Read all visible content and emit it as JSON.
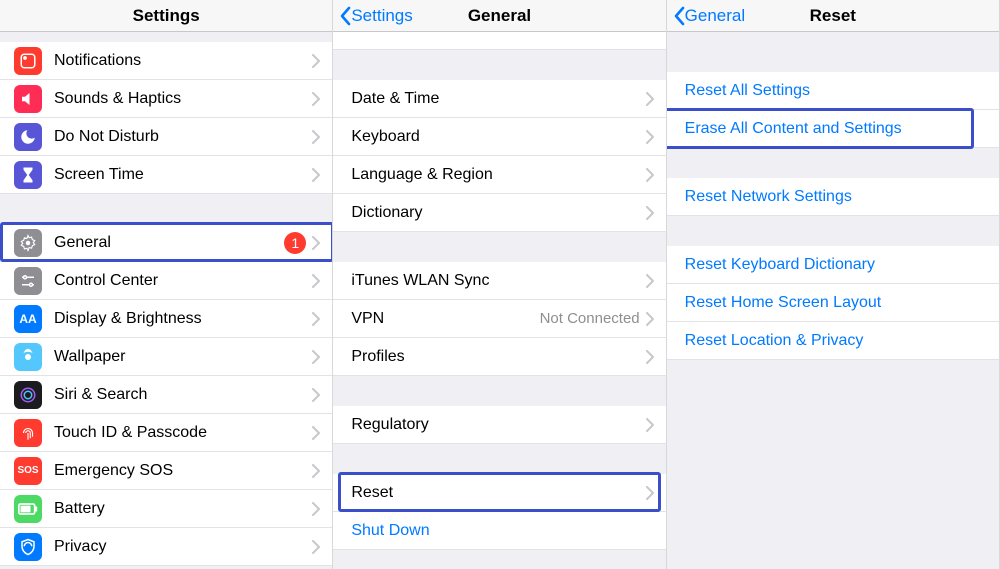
{
  "settings": {
    "title": "Settings",
    "items": [
      {
        "key": "notifications",
        "label": "Notifications",
        "iconClass": "bg-red"
      },
      {
        "key": "sounds",
        "label": "Sounds & Haptics",
        "iconClass": "bg-pink"
      },
      {
        "key": "dnd",
        "label": "Do Not Disturb",
        "iconClass": "bg-purple"
      },
      {
        "key": "screentime",
        "label": "Screen Time",
        "iconClass": "bg-hourglass"
      },
      {
        "key": "general",
        "label": "General",
        "iconClass": "bg-gray",
        "badge": "1",
        "highlight": true
      },
      {
        "key": "controlcenter",
        "label": "Control Center",
        "iconClass": "bg-gray"
      },
      {
        "key": "display",
        "label": "Display & Brightness",
        "iconClass": "bg-blue"
      },
      {
        "key": "wallpaper",
        "label": "Wallpaper",
        "iconClass": "bg-wallpaper"
      },
      {
        "key": "siri",
        "label": "Siri & Search",
        "iconClass": "bg-black"
      },
      {
        "key": "touchid",
        "label": "Touch ID & Passcode",
        "iconClass": "bg-red"
      },
      {
        "key": "sos",
        "label": "Emergency SOS",
        "iconClass": "bg-sos"
      },
      {
        "key": "battery",
        "label": "Battery",
        "iconClass": "bg-green"
      },
      {
        "key": "privacy",
        "label": "Privacy",
        "iconClass": "bg-blue"
      }
    ]
  },
  "general": {
    "back": "Settings",
    "title": "General",
    "group1": [
      {
        "label": "Date & Time"
      },
      {
        "label": "Keyboard"
      },
      {
        "label": "Language & Region"
      },
      {
        "label": "Dictionary"
      }
    ],
    "group2": [
      {
        "label": "iTunes WLAN Sync"
      },
      {
        "label": "VPN",
        "detail": "Not Connected"
      },
      {
        "label": "Profiles"
      }
    ],
    "group3": [
      {
        "label": "Regulatory"
      }
    ],
    "group4": [
      {
        "label": "Reset",
        "highlight": true
      },
      {
        "label": "Shut Down",
        "blue": true,
        "noChevron": true
      }
    ]
  },
  "reset": {
    "back": "General",
    "title": "Reset",
    "group1": [
      {
        "label": "Reset All Settings"
      },
      {
        "label": "Erase All Content and Settings",
        "highlight": true
      }
    ],
    "group2": [
      {
        "label": "Reset Network Settings"
      }
    ],
    "group3": [
      {
        "label": "Reset Keyboard Dictionary"
      },
      {
        "label": "Reset Home Screen Layout"
      },
      {
        "label": "Reset Location & Privacy"
      }
    ]
  }
}
